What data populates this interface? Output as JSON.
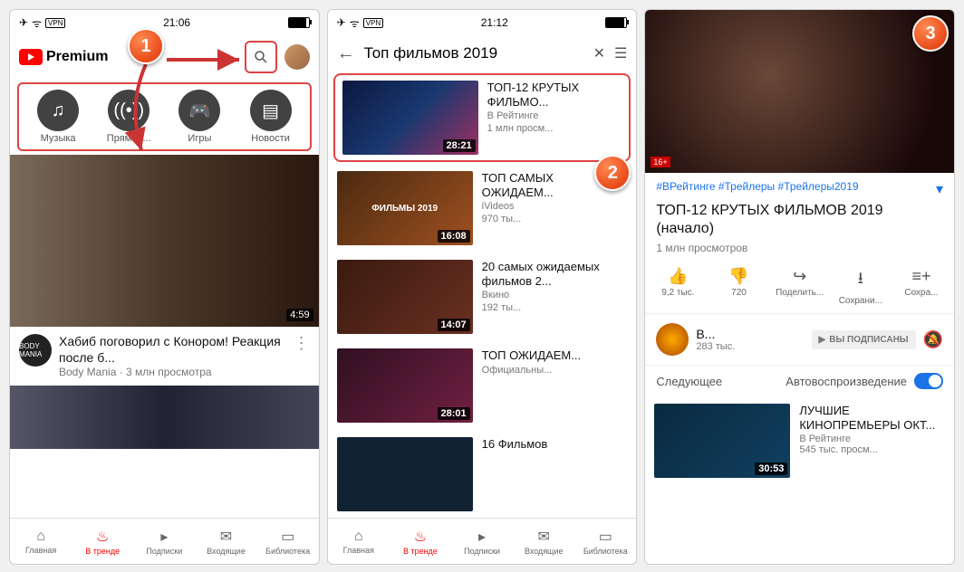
{
  "statusbar": {
    "time": "21:06",
    "time2": "21:12"
  },
  "screen1": {
    "premium": "Premium",
    "tabs": [
      {
        "label": "Музыка"
      },
      {
        "label": "Прямой..."
      },
      {
        "label": "Игры"
      },
      {
        "label": "Новости"
      }
    ],
    "video1": {
      "duration": "4:59",
      "title": "Хабиб поговорил с Конором! Реакция после б...",
      "channel": "Body Mania · 3 млн просмотра",
      "channel_icon": "BODY MANIA"
    }
  },
  "bottomnav": [
    {
      "label": "Главная"
    },
    {
      "label": "В тренде"
    },
    {
      "label": "Подписки"
    },
    {
      "label": "Входящие"
    },
    {
      "label": "Библиотека"
    }
  ],
  "screen2": {
    "query": "Топ фильмов 2019",
    "results": [
      {
        "title": "ТОП-12 КРУТЫХ ФИЛЬМО...",
        "channel": "В Рейтинге",
        "views": "1 млн просм...",
        "duration": "28:21",
        "thumb_bg": "linear-gradient(135deg,#0a1840,#1a3870,#a03060)",
        "thumb_text": ""
      },
      {
        "title": "ТОП САМЫХ ОЖИДАЕМ...",
        "channel": "iVideos",
        "views": "970 ты...",
        "duration": "16:08",
        "thumb_bg": "linear-gradient(135deg,#4a2a10,#a05020)",
        "thumb_text": "ФИЛЬМЫ 2019"
      },
      {
        "title": "20 самых ожидаемых фильмов 2...",
        "channel": "Вкино",
        "views": "192 ты...",
        "duration": "14:07",
        "thumb_bg": "linear-gradient(135deg,#3a1a10,#6a3020)",
        "thumb_text": ""
      },
      {
        "title": "ТОП ОЖИДАЕМ...",
        "channel": "Официальны...",
        "views": "",
        "duration": "28:01",
        "thumb_bg": "linear-gradient(135deg,#301020,#702040)",
        "thumb_text": ""
      },
      {
        "title": "16 Фильмов",
        "channel": "",
        "views": "",
        "duration": "",
        "thumb_bg": "#123",
        "thumb_text": ""
      }
    ]
  },
  "screen3": {
    "age": "16+",
    "tags": "#ВРейтинге #Трейлеры #Трейлеры2019",
    "title": "ТОП-12 КРУТЫХ ФИЛЬМОВ 2019 (начало)",
    "views": "1 млн просмотров",
    "actions": {
      "likes": "9,2 тыс.",
      "dislikes": "720",
      "share": "Поделить...",
      "download": "Сохрани...",
      "save": "Сохра..."
    },
    "channel": {
      "name": "В...",
      "subs": "283 тыс.",
      "subscribed": "ВЫ ПОДПИСАНЫ"
    },
    "upnext": {
      "label": "Следующее",
      "autoplay": "Автовоспроизведение",
      "item": {
        "title": "ЛУЧШИЕ КИНОПРЕМЬЕРЫ ОКТ...",
        "sub": "В Рейтинге\n545 тыс. просм...",
        "duration": "30:53"
      }
    }
  },
  "markers": {
    "m1": "1",
    "m2": "2",
    "m3": "3"
  }
}
